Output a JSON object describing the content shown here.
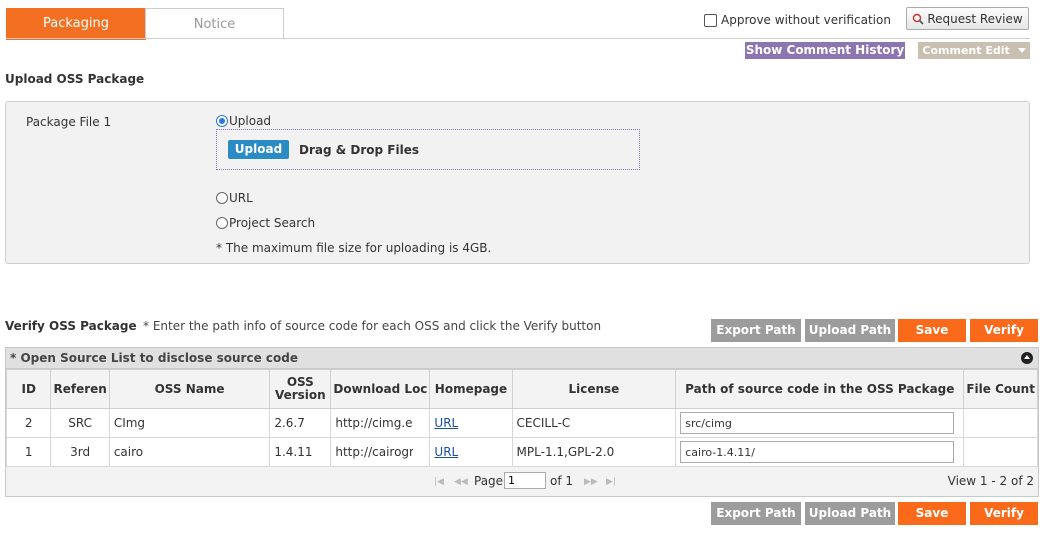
{
  "tabs": {
    "active": "Packaging",
    "inactive": "Notice"
  },
  "header": {
    "approve_label": "Approve without verification",
    "request_review": "Request Review",
    "show_comment_history": "Show Comment History",
    "comment_edit": "Comment Edit"
  },
  "upload_section": {
    "title": "Upload OSS Package",
    "package_label": "Package File 1",
    "radio_upload": "Upload",
    "upload_button": "Upload",
    "drag_drop": "Drag & Drop Files",
    "radio_url": "URL",
    "radio_project_search": "Project Search",
    "max_size_note": "* The maximum file size for uploading is 4GB."
  },
  "verify_section": {
    "title": "Verify OSS Package",
    "hint": "* Enter the path info of source code for each OSS and click the Verify button",
    "buttons": {
      "export_path": "Export Path",
      "upload_path": "Upload Path",
      "save": "Save",
      "verify": "Verify"
    }
  },
  "grid": {
    "caption": "* Open Source List to disclose source code",
    "columns": {
      "id": "ID",
      "reference": "Referen",
      "oss_name": "OSS Name",
      "oss_version_1": "OSS",
      "oss_version_2": "Version",
      "download": "Download Loc",
      "homepage": "Homepage",
      "license": "License",
      "path": "Path of source code in the OSS Package",
      "file_count": "File Count"
    },
    "rows": [
      {
        "id": "2",
        "reference": "SRC",
        "oss_name": "CImg",
        "version": "2.6.7",
        "download": "http://cimg.eu/",
        "homepage": "URL",
        "license": "CECILL-C",
        "path": "src/cimg",
        "file_count": ""
      },
      {
        "id": "1",
        "reference": "3rd",
        "oss_name": "cairo",
        "version": "1.4.11",
        "download": "http://cairographics.org",
        "homepage": "URL",
        "license": "MPL-1.1,GPL-2.0",
        "path": "cairo-1.4.11/",
        "file_count": ""
      }
    ],
    "pager": {
      "page_label": "Page",
      "page_value": "1",
      "of_label": "of 1",
      "view_info": "View 1 - 2 of 2"
    }
  },
  "colors": {
    "orange": "#fb6a1b",
    "purple": "#8c75b0",
    "gray_button": "#9c9c9c",
    "upload_blue": "#2b8bc4"
  },
  "icons": [
    "search-icon",
    "chevron-down-icon",
    "collapse-icon",
    "first-page-icon",
    "prev-page-icon",
    "next-page-icon",
    "last-page-icon"
  ]
}
